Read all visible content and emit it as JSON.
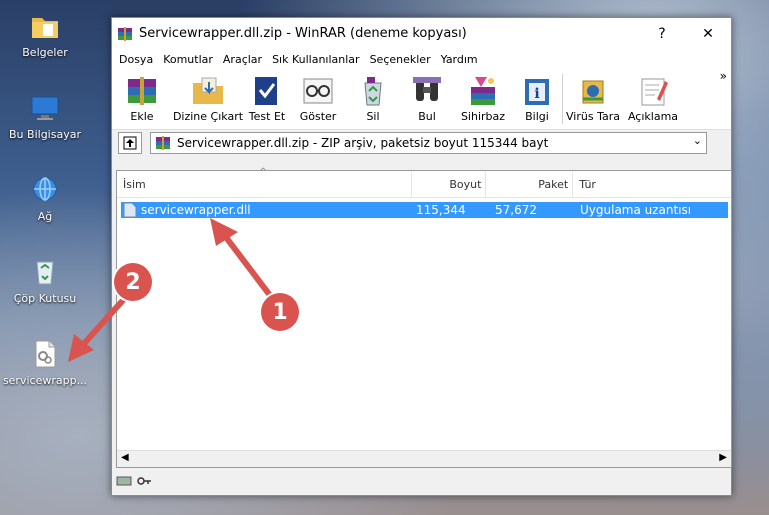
{
  "desktop": {
    "icons": [
      {
        "label": "Belgeler",
        "icon": "folder-documents-icon"
      },
      {
        "label": "Bu Bilgisayar",
        "icon": "computer-icon"
      },
      {
        "label": "Ağ",
        "icon": "network-icon"
      },
      {
        "label": "Çöp Kutusu",
        "icon": "recycle-bin-icon"
      },
      {
        "label": "servicewrapp...",
        "icon": "dll-file-icon"
      }
    ]
  },
  "window": {
    "title": "Servicewrapper.dll.zip - WinRAR (deneme kopyası)",
    "help": "?",
    "close": "✕",
    "menu": [
      "Dosya",
      "Komutlar",
      "Araçlar",
      "Sık Kullanılanlar",
      "Seçenekler",
      "Yardım"
    ],
    "toolbar": [
      "Ekle",
      "Dizine Çıkart",
      "Test Et",
      "Göster",
      "Sil",
      "Bul",
      "Sihirbaz",
      "Bilgi",
      "Virüs Tara",
      "Açıklama"
    ],
    "toolbar_more": "»",
    "address": "Servicewrapper.dll.zip - ZIP arşiv, paketsiz boyut 115344 bayt",
    "columns": [
      "İsim",
      "Boyut",
      "Paket",
      "Tür"
    ],
    "files": [
      {
        "name": "servicewrapper.dll",
        "size": "115,344",
        "packed": "57,672",
        "type": "Uygulama uzantısı"
      }
    ]
  },
  "annotations": [
    "1",
    "2"
  ],
  "colors": {
    "selection": "#3399ff",
    "marker": "#d9534f"
  }
}
